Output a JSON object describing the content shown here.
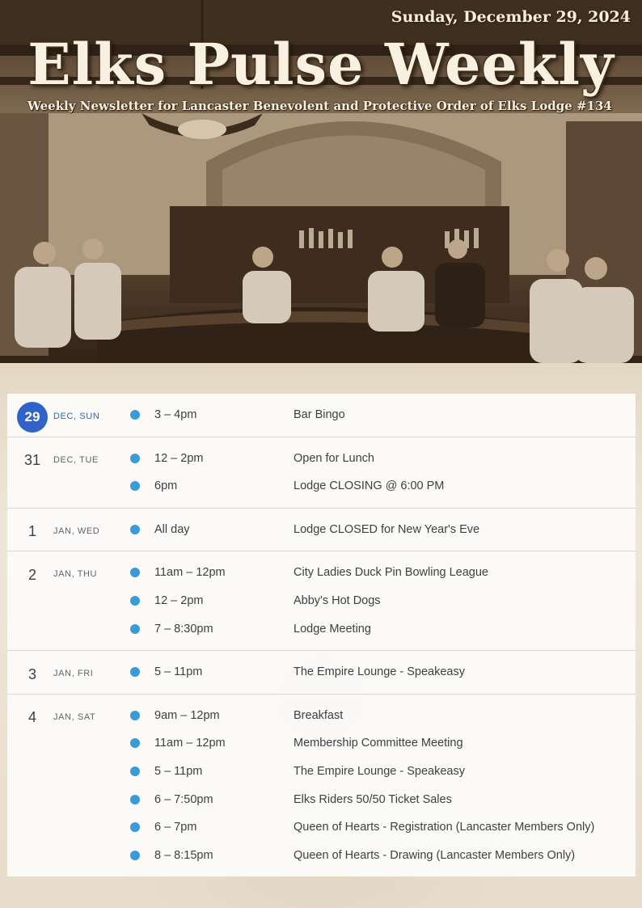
{
  "header": {
    "date": "Sunday, December 29, 2024",
    "title": "Elks Pulse Weekly",
    "subtitle": "Weekly Newsletter for Lancaster Benevolent and Protective Order of Elks Lodge #134"
  },
  "colors": {
    "today_accent": "#2f63c9",
    "event_dot": "#3b9bd9",
    "masthead_text": "#f8f1e2"
  },
  "days": [
    {
      "num": "29",
      "label": "DEC, SUN",
      "today": true,
      "events": [
        {
          "time": "3 – 4pm",
          "title": "Bar Bingo"
        }
      ]
    },
    {
      "num": "31",
      "label": "DEC, TUE",
      "today": false,
      "events": [
        {
          "time": "12 – 2pm",
          "title": "Open for Lunch"
        },
        {
          "time": "6pm",
          "title": "Lodge CLOSING @ 6:00 PM"
        }
      ]
    },
    {
      "num": "1",
      "label": "JAN, WED",
      "today": false,
      "events": [
        {
          "time": "All day",
          "title": "Lodge CLOSED for New Year's Eve"
        }
      ]
    },
    {
      "num": "2",
      "label": "JAN, THU",
      "today": false,
      "events": [
        {
          "time": "11am – 12pm",
          "title": "City Ladies Duck Pin Bowling League"
        },
        {
          "time": "12 – 2pm",
          "title": "Abby's Hot Dogs"
        },
        {
          "time": "7 – 8:30pm",
          "title": "Lodge Meeting"
        }
      ]
    },
    {
      "num": "3",
      "label": "JAN, FRI",
      "today": false,
      "events": [
        {
          "time": "5 – 11pm",
          "title": "The Empire Lounge - Speakeasy"
        }
      ]
    },
    {
      "num": "4",
      "label": "JAN, SAT",
      "today": false,
      "events": [
        {
          "time": "9am – 12pm",
          "title": "Breakfast"
        },
        {
          "time": "11am – 12pm",
          "title": "Membership Committee Meeting"
        },
        {
          "time": "5 – 11pm",
          "title": "The Empire Lounge - Speakeasy"
        },
        {
          "time": "6 – 7:50pm",
          "title": "Elks Riders 50/50 Ticket Sales"
        },
        {
          "time": "6 – 7pm",
          "title": "Queen of Hearts - Registration (Lancaster Members Only)"
        },
        {
          "time": "8 – 8:15pm",
          "title": "Queen of Hearts - Drawing (Lancaster Members Only)"
        }
      ]
    }
  ]
}
